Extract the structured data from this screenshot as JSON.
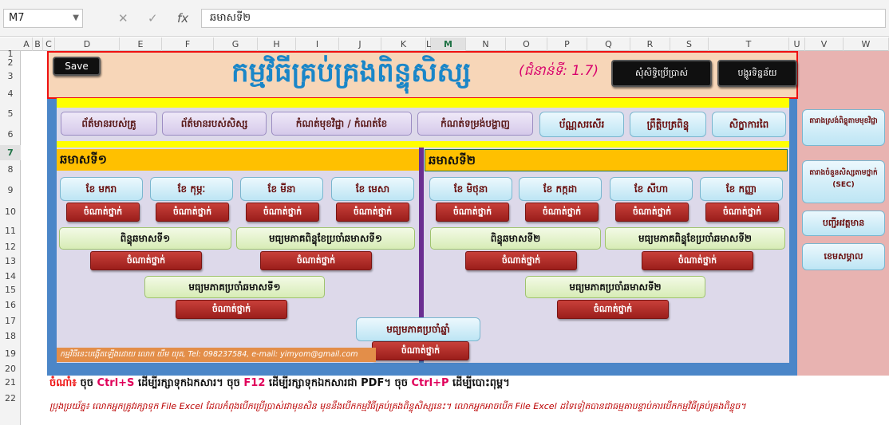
{
  "formula_bar": {
    "name_box": "M7",
    "cancel_icon": "✕",
    "enter_icon": "✓",
    "fx_icon": "fx",
    "content": "ឆមាសទី២"
  },
  "columns": [
    "A",
    "B",
    "C",
    "D",
    "E",
    "F",
    "G",
    "H",
    "I",
    "J",
    "K",
    "L",
    "M",
    "N",
    "O",
    "P",
    "Q",
    "R",
    "S",
    "T",
    "U",
    "V",
    "W"
  ],
  "rows": [
    "1",
    "2",
    "3",
    "4",
    "5",
    "6",
    "7",
    "8",
    "9",
    "10",
    "11",
    "12",
    "13",
    "14",
    "15",
    "16",
    "17",
    "18",
    "19",
    "20",
    "21",
    "22"
  ],
  "header": {
    "save": "Save",
    "title": "កម្មវិធីគ្រប់គ្រងពិន្ទុសិស្ស",
    "version": "(ជំនាន់ទី: 1.7)",
    "request_button": "សុំសិទ្ធិប្រើប្រាស់",
    "clear_button": "បង្ហូរទិន្នន័យ"
  },
  "menu": [
    "ព័ត៌មានរបស់គ្រូ",
    "ព័ត៌មានរបស់សិស្ស",
    "កំណត់មុខវិជ្ជា / កំណត់ខែ",
    "កំណត់ទម្រង់បង្ហាញ",
    "ប័ណ្ណសរសើរ",
    "ព្រឹត្តិបត្រពិន្ទុ",
    "សិក្ខាការពៃ"
  ],
  "semester1": {
    "title": "ឆមាសទី១",
    "months": [
      "ខែ មករា",
      "ខែ កុម្ភៈ",
      "ខែ មីនា",
      "ខែ មេសា"
    ],
    "set_grade": "ចំណាត់ថ្នាក់",
    "score": "ពិន្ទុឆមាសទី១",
    "avg_score": "មធ្យមភាគពិន្ទុខែប្រចាំឆមាសទី១",
    "avg_semester": "មធ្យមភាគប្រចាំឆមាសទី១"
  },
  "semester2": {
    "title": "ឆមាសទី២",
    "months": [
      "ខែ មិថុនា",
      "ខែ កក្កដា",
      "ខែ សីហា",
      "ខែ កញ្ញា"
    ],
    "set_grade": "ចំណាត់ថ្នាក់",
    "score": "ពិន្ទុឆមាសទី២",
    "avg_score": "មធ្យមភាគពិន្ទុខែប្រចាំឆមាសទី២",
    "avg_semester": "មធ្យមភាគប្រចាំឆមាសទី២"
  },
  "annual": {
    "avg_year": "មធ្យមភាគប្រចាំឆ្នាំ",
    "set_grade": "ចំណាត់ថ្នាក់"
  },
  "credit": "កម្មវិធីនេះបង្កើតឡើងដោយ លោក យឹម យុគ, Tel: 098237584, e-mail: yimyom@gmail.com",
  "side_buttons": [
    "តារាងស្រង់ពិន្ទុតាមមុខវិជ្ជា",
    "តារាងចំនួនសិស្សតាមថ្នាក់ (SEC)",
    "បញ្ជីអវត្តមាន",
    "ខេមសម្គាល"
  ],
  "notes": {
    "label": "ចំណាំ៖",
    "part1": " ចុច ",
    "ctrl_s": "Ctrl+S",
    "part2": " ដើម្បីរក្សាទុកឯកសារ។ ចុច ",
    "f12": "F12",
    "part3": " ដើម្បីរក្សាទុកឯកសារជា PDF។ ចុច ",
    "ctrl_p": "Ctrl+P",
    "part4": " ដើម្បីបោះពុម្ព។",
    "warning": "ប្រុងប្រយ័ត្ន៖ លោកអ្នកត្រូវរក្សាទុក File Excel ដែលកំពុងបើកប្រើប្រាស់ជាមុនសិន មុននឹងបើកកម្មវិធីគ្រប់គ្រងពិន្ទុសិស្សនេះ។ លោកអ្នកអាចបើក File Excel ដទៃទៀតបានជាធម្មតាបន្ទាប់ការបើកកម្មវិធីគ្រប់គ្រងពិន្ទុច។"
  }
}
